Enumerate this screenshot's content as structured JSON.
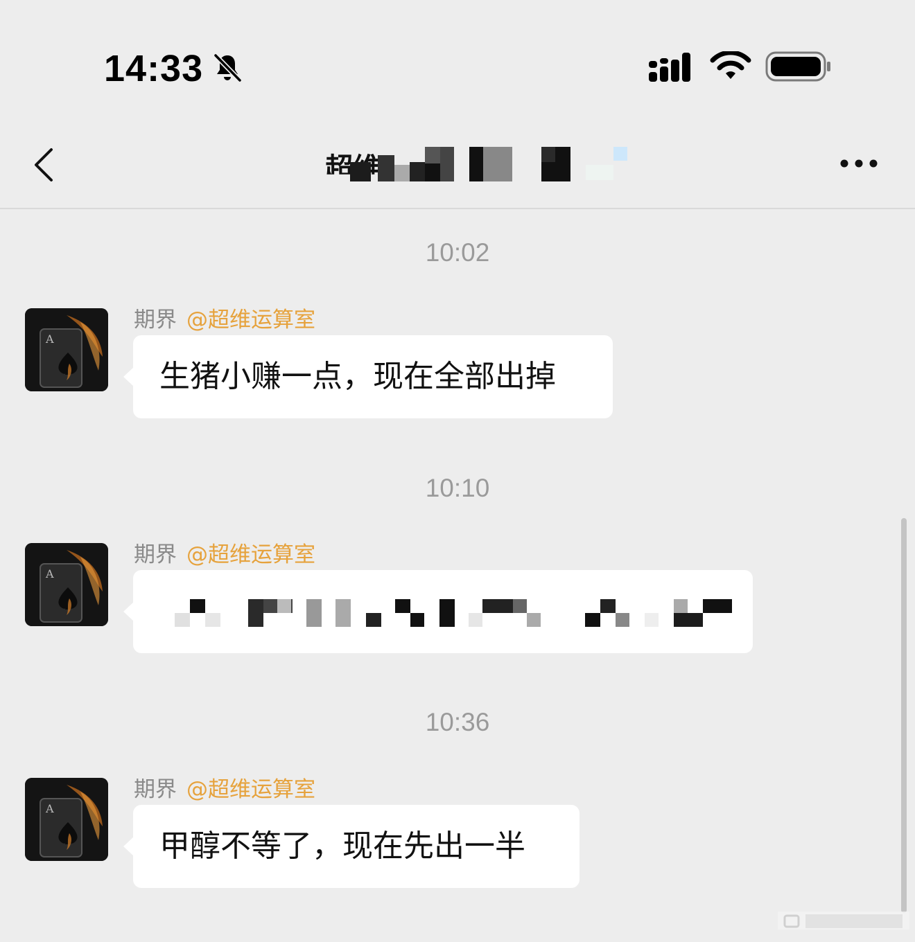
{
  "status_bar": {
    "time": "14:33",
    "icons": [
      "bell-muted-icon",
      "cellular-signal-icon",
      "wifi-icon",
      "battery-icon"
    ]
  },
  "nav_bar": {
    "back_icon": "chevron-left-icon",
    "title_partial": "超维",
    "more_icon": "ellipsis-icon"
  },
  "messages": [
    {
      "timestamp": "10:02",
      "sender": "期界",
      "mention": "@超维运算室",
      "text": "生猪小赚一点，现在全部出掉"
    },
    {
      "timestamp": "10:10",
      "sender": "期界",
      "mention": "@超维运算室",
      "text": ""
    },
    {
      "timestamp": "10:36",
      "sender": "期界",
      "mention": "@超维运算室",
      "text": "甲醇不等了，现在先出一半"
    }
  ],
  "colors": {
    "background": "#ededed",
    "bubble": "#ffffff",
    "mention": "#e6a23c",
    "timestamp": "#9a9a9a"
  }
}
